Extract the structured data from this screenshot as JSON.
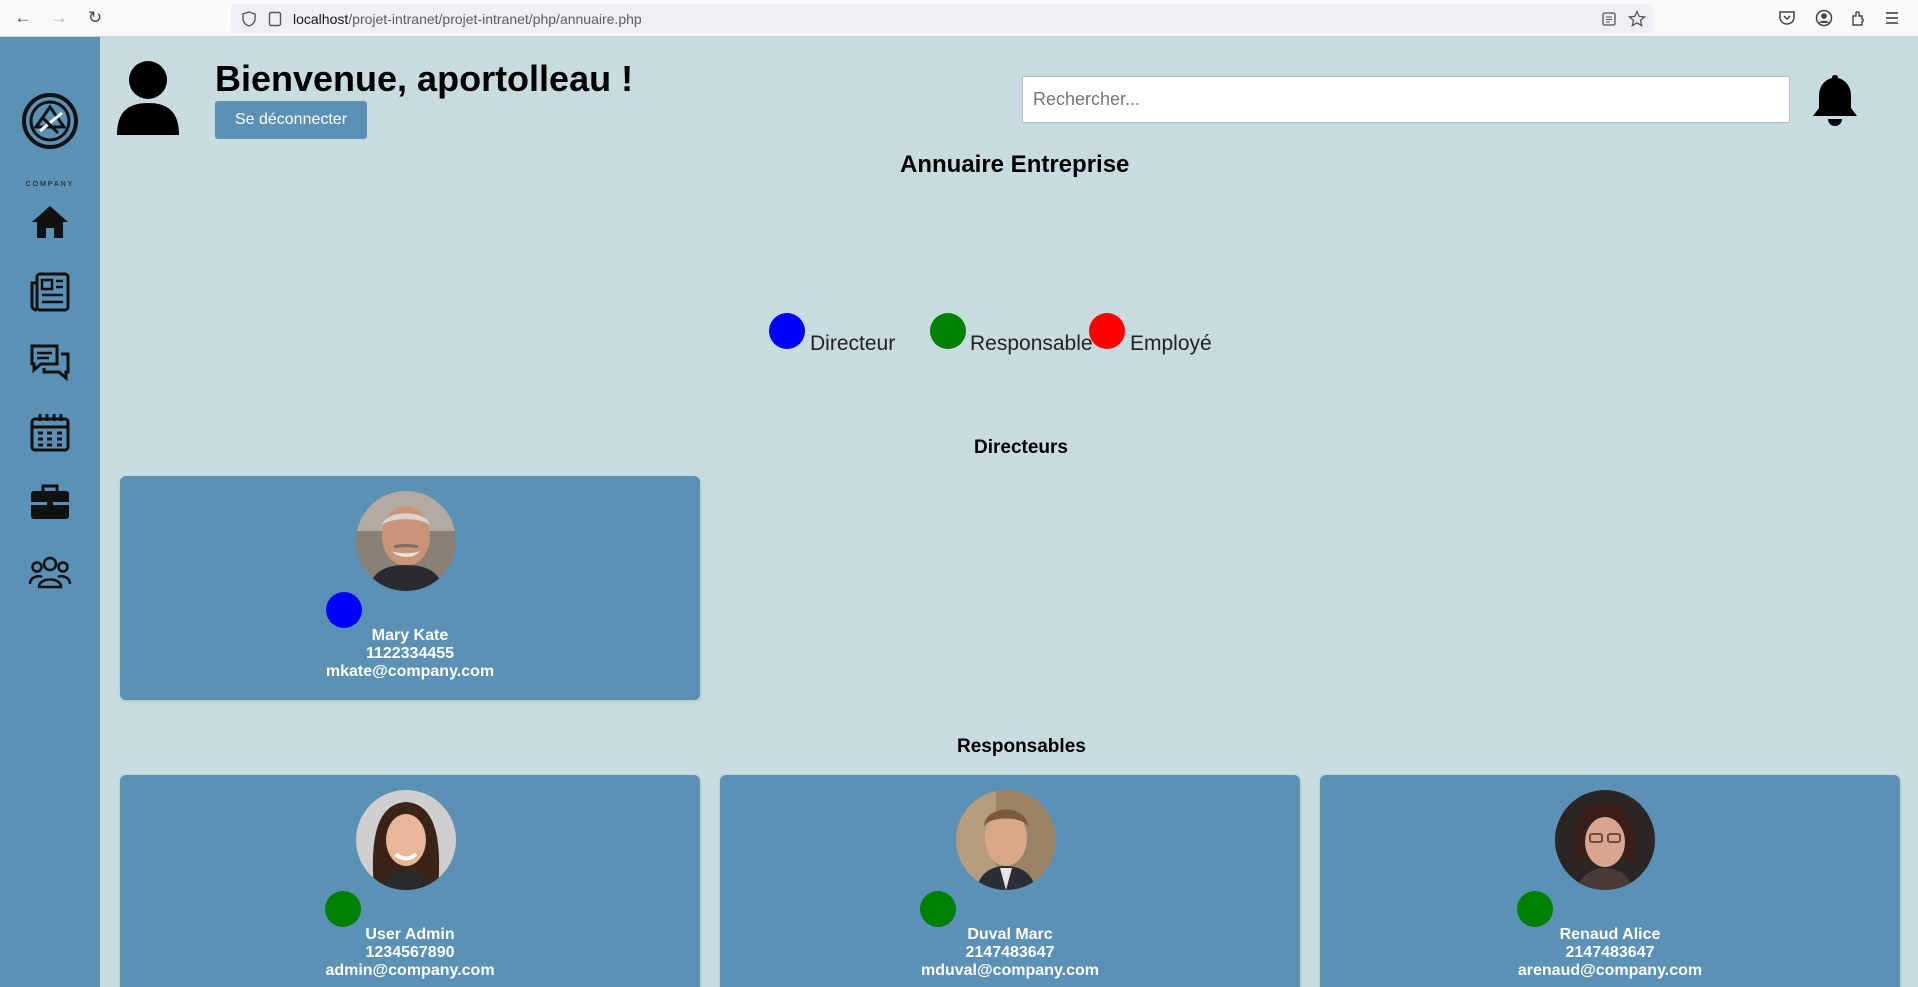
{
  "browser": {
    "url_host": "localhost",
    "url_path": "/projet-intranet/projet-intranet/php/annuaire.php"
  },
  "sidebar": {
    "logo_text": "COMPANY",
    "items": [
      {
        "icon": "home-icon"
      },
      {
        "icon": "newspaper-icon"
      },
      {
        "icon": "chat-icon"
      },
      {
        "icon": "calendar-icon"
      },
      {
        "icon": "briefcase-icon"
      },
      {
        "icon": "users-icon"
      }
    ]
  },
  "header": {
    "welcome": "Bienvenue, aportolleau !",
    "logout_label": "Se déconnecter",
    "search_placeholder": "Rechercher..."
  },
  "page_title": "Annuaire Entreprise",
  "legend": {
    "director": "Directeur",
    "manager": "Responsable",
    "employee": "Employé"
  },
  "colors": {
    "director": "#0000ff",
    "manager": "#008000",
    "employee": "#ff0000",
    "accent": "#5a91b4",
    "background": "#c8dce0"
  },
  "sections": {
    "directors_title": "Directeurs",
    "managers_title": "Responsables"
  },
  "directors": [
    {
      "name": "Mary Kate",
      "phone": "1122334455",
      "email": "mkate@company.com"
    }
  ],
  "managers": [
    {
      "name": "User Admin",
      "phone": "1234567890",
      "email": "admin@company.com"
    },
    {
      "name": "Duval Marc",
      "phone": "2147483647",
      "email": "mduval@company.com"
    },
    {
      "name": "Renaud Alice",
      "phone": "2147483647",
      "email": "arenaud@company.com"
    }
  ]
}
